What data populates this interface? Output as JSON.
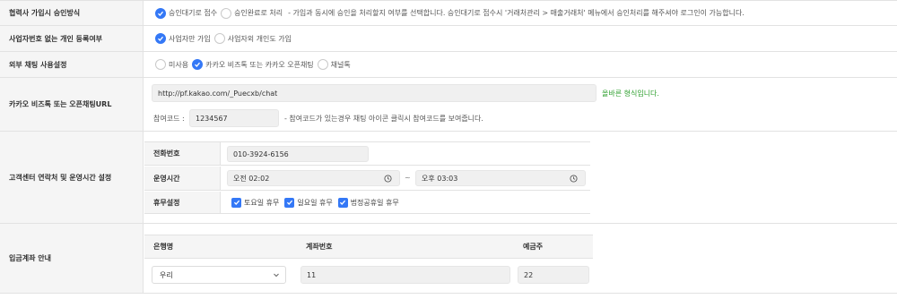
{
  "approval": {
    "label": "협력사 가입시 승인방식",
    "option_wait": "승인대기로 접수",
    "option_done": "승인완료로 처리",
    "note": "- 가입과 동시에 승인을 처리할지 여부를 선택합니다. 승인대기로 접수시 '거래처관리 > 매출거래처' 메뉴에서 승인처리를 해주셔야 로그인이 가능합니다.",
    "selected": "option_wait"
  },
  "personal": {
    "label": "사업자번호 없는 개인 등록여부",
    "option_biz_only": "사업자만 가입",
    "option_allow_personal": "사업자외 개인도 가입",
    "selected": "option_biz_only"
  },
  "chat": {
    "label": "외부 채팅 사용설정",
    "option_none": "미사용",
    "option_kakao": "카카오 비즈톡 또는 카카오 오픈채팅",
    "option_channeltalk": "채널톡",
    "selected": "option_kakao"
  },
  "kakao": {
    "label": "카카오 비즈톡 또는 오픈채팅URL",
    "url": "http://pf.kakao.com/_Puecxb/chat",
    "valid_msg": "올바른 형식입니다.",
    "code_label": "참여코드 :",
    "code_value": "1234567",
    "code_note": "- 참여코드가 있는경우 채팅 아이콘 클릭시 참여코드를 보여줍니다."
  },
  "support": {
    "label": "고객센터 연락처 및 운영시간 설정",
    "phone_label": "전화번호",
    "phone_value": "010-3924-6156",
    "hours_label": "운영시간",
    "hours_start": "오전 02:02",
    "hours_sep": "~",
    "hours_end": "오후 03:03",
    "holiday_label": "휴무설정",
    "holiday_sat": "토요일 휴무",
    "holiday_sun": "일요일 휴무",
    "holiday_public": "법정공휴일 휴무"
  },
  "deposit": {
    "label": "입금계좌 안내",
    "col_bank": "은행명",
    "col_account": "계좌번호",
    "col_holder": "예금주",
    "bank_value": "우리",
    "account_value": "11",
    "holder_value": "22"
  },
  "colors": {
    "accent": "#3478f6",
    "valid": "#2e9f2e",
    "label_bg": "#f5f5f5",
    "border": "#e2e2e2"
  },
  "icons": {
    "radio_checked": "check-circle-icon",
    "checkbox_checked": "checkbox-check-icon",
    "clock": "clock-icon",
    "select": "chevron-down-icon"
  }
}
